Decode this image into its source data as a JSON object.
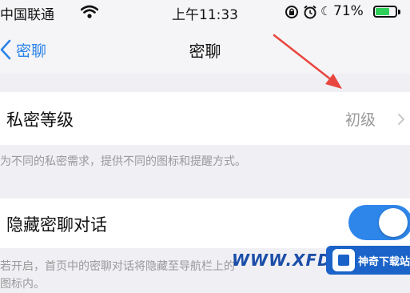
{
  "status_bar": {
    "carrier": "中国联通",
    "time": "上午11:33",
    "battery_percent": "71%",
    "battery_level": 0.71,
    "icons": [
      "wifi-icon",
      "rotation-lock-icon",
      "alarm-icon",
      "moon-icon",
      "battery-icon"
    ]
  },
  "nav": {
    "back_label": "密聊",
    "title": "密聊"
  },
  "privacy_level": {
    "label": "私密等级",
    "value": "初级",
    "description": "为不同的私密需求，提供不同的图标和提醒方式。"
  },
  "hide_chat": {
    "label": "隐藏密聊对话",
    "toggle_on": true,
    "description_line1": "若开启，首页中的密聊对话将隐藏至导航栏上的",
    "description_line2": "图标内。"
  },
  "annotation": {
    "arrow_color": "#e8473f"
  },
  "watermark": {
    "url_text": "WWW.XFDO",
    "site_label": "神奇下载站"
  },
  "colors": {
    "accent": "#2f86ea",
    "background": "#efeff4",
    "secondary_text": "#999999"
  }
}
